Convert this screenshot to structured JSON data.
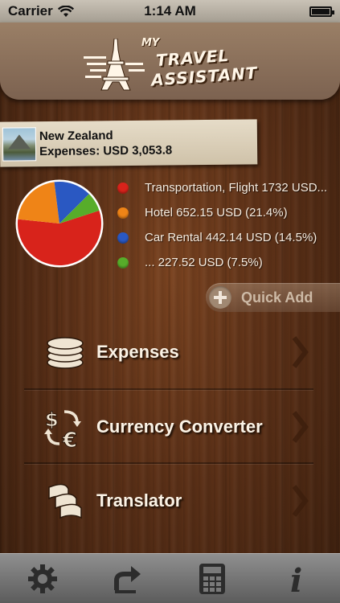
{
  "status_bar": {
    "carrier": "Carrier",
    "time": "1:14 AM"
  },
  "header": {
    "logo_my": "MY",
    "logo_line1": "TRAVEL",
    "logo_line2": "ASSISTANT"
  },
  "trip": {
    "name": "New Zealand",
    "expenses": "Expenses: USD 3,053.8"
  },
  "chart_data": {
    "type": "pie",
    "slices": [
      {
        "label": "Transportation, Flight 1732 USD...",
        "percent": 56.7,
        "color": "#d8231b"
      },
      {
        "label": "Hotel 652.15 USD (21.4%)",
        "percent": 21.4,
        "color": "#ef8417"
      },
      {
        "label": "Car Rental 442.14 USD (14.5%)",
        "percent": 14.5,
        "color": "#2a58c2"
      },
      {
        "label": "... 227.52 USD (7.5%)",
        "percent": 7.5,
        "color": "#57ad2a"
      }
    ]
  },
  "quick_add": {
    "label": "Quick Add"
  },
  "menu": [
    {
      "label": "Expenses",
      "icon": "coins-icon"
    },
    {
      "label": "Currency Converter",
      "icon": "currency-exchange-icon"
    },
    {
      "label": "Translator",
      "icon": "translator-icon"
    }
  ],
  "tabbar": [
    {
      "icon": "gear-icon"
    },
    {
      "icon": "share-arrow-icon"
    },
    {
      "icon": "calculator-icon"
    },
    {
      "icon": "info-icon"
    }
  ],
  "colors": {
    "wood_dark": "#3b1f0e",
    "wood_mid": "#5b3017",
    "card": "#e6dcc8",
    "text_light": "#f6ece0"
  }
}
